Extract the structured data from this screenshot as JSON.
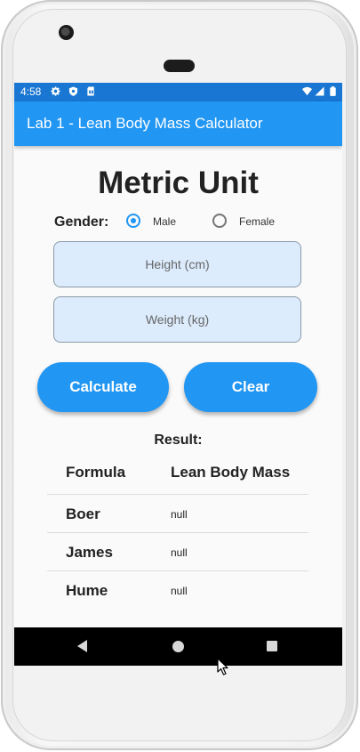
{
  "status_bar": {
    "time": "4:58",
    "left_icons": [
      "gear-icon",
      "shield-icon",
      "sim-card-icon"
    ],
    "right_icons": [
      "wifi-icon",
      "signal-icon",
      "battery-icon"
    ],
    "color": "#1976d2"
  },
  "app_bar": {
    "title": "Lab 1 - Lean Body Mass Calculator",
    "color": "#2196f3"
  },
  "main": {
    "heading": "Metric Unit",
    "gender": {
      "label": "Gender:",
      "options": [
        {
          "label": "Male",
          "selected": true
        },
        {
          "label": "Female",
          "selected": false
        }
      ]
    },
    "height_field": {
      "placeholder": "Height (cm)",
      "value": ""
    },
    "weight_field": {
      "placeholder": "Weight (kg)",
      "value": ""
    },
    "buttons": {
      "calculate": "Calculate",
      "clear": "Clear"
    },
    "result_label": "Result:",
    "table": {
      "headers": [
        "Formula",
        "Lean Body Mass"
      ],
      "rows": [
        {
          "formula": "Boer",
          "value": "null"
        },
        {
          "formula": "James",
          "value": "null"
        },
        {
          "formula": "Hume",
          "value": "null"
        }
      ]
    }
  },
  "nav_bar": {
    "icons": [
      "back-icon",
      "home-icon",
      "recent-apps-icon"
    ]
  },
  "colors": {
    "accent": "#2196f3",
    "field_fill": "#dcecfd"
  }
}
